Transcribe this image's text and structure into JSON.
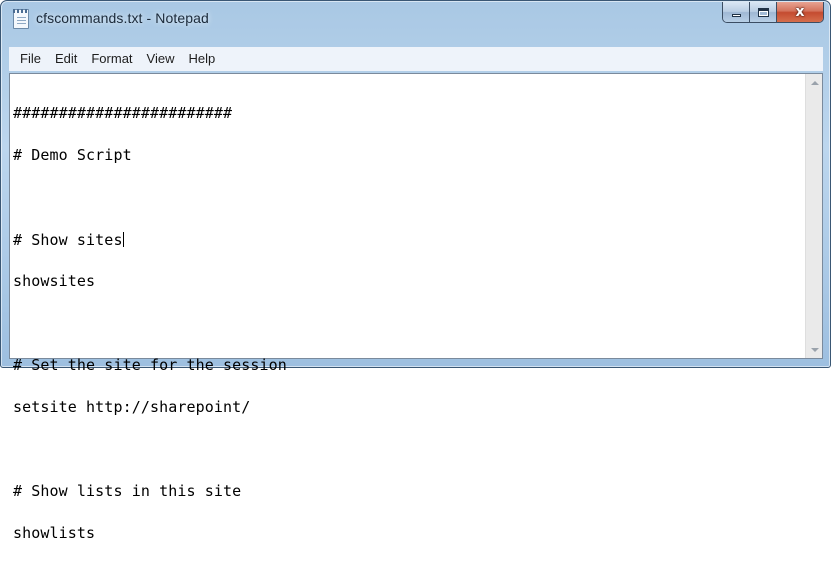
{
  "window": {
    "title": "cfscommands.txt - Notepad",
    "icon": "notepad-icon",
    "controls": {
      "minimize_icon": "minimize-icon",
      "maximize_icon": "maximize-icon",
      "close_icon": "close-icon",
      "close_glyph": "x"
    }
  },
  "menu": {
    "items": [
      "File",
      "Edit",
      "Format",
      "View",
      "Help"
    ]
  },
  "editor": {
    "lines": [
      "########################",
      "# Demo Script",
      "",
      "# Show sites",
      "showsites",
      "",
      "# Set the site for the session",
      "setsite http://sharepoint/",
      "",
      "# Show lists in this site",
      "showlists"
    ],
    "caret_line": 3
  },
  "scrollbar": {
    "up_icon": "scroll-up-arrow-icon",
    "down_icon": "scroll-down-arrow-icon"
  },
  "colors": {
    "frame": "#a9c8e4",
    "close_button": "#c44b30",
    "menu_background": "#eef3fa",
    "editor_background": "#ffffff"
  }
}
